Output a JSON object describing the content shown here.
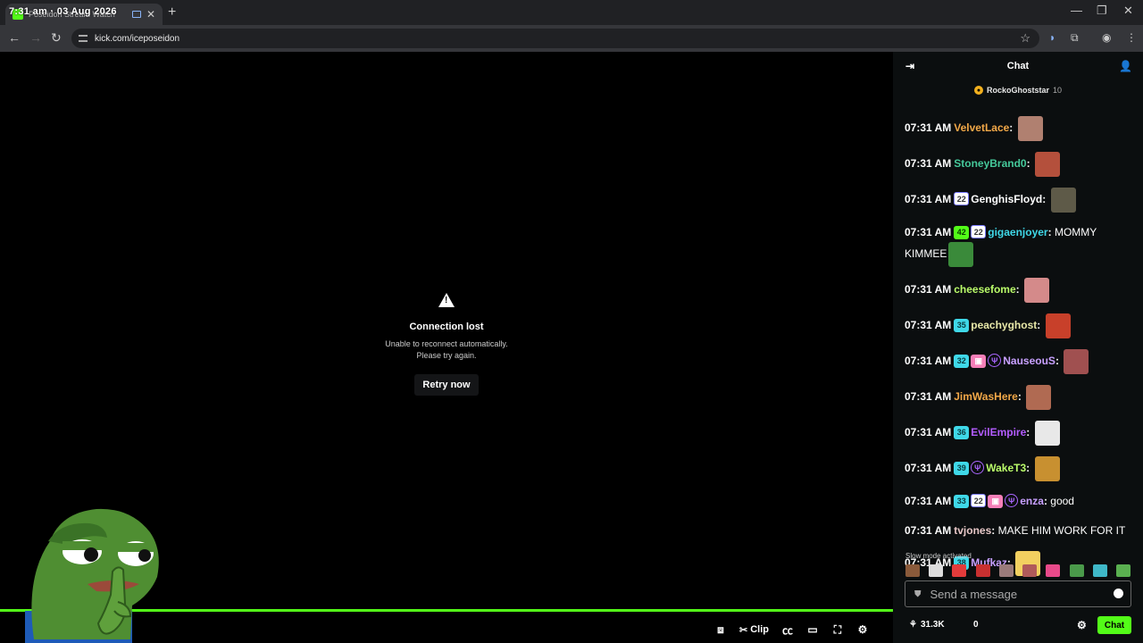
{
  "browser": {
    "tab_title": "Poseidon Stream Watch",
    "clock_overlay": "7:31 am · 03 Aug 2026",
    "url": "kick.com/iceposeidon"
  },
  "player": {
    "error_title": "Connection lost",
    "error_message_line1": "Unable to reconnect automatically.",
    "error_message_line2": "Please try again.",
    "retry_label": "Retry now",
    "clip_label": "Clip"
  },
  "chat": {
    "header": "Chat",
    "pinned": {
      "user": "RockoGhoststar",
      "count": "10"
    },
    "messages": [
      {
        "time": "07:31 AM",
        "user": "VelvetLace",
        "color": "#f2a848",
        "badges": [],
        "text": "",
        "emote": "#b08070"
      },
      {
        "time": "07:31 AM",
        "user": "StoneyBrand0",
        "color": "#45c89a",
        "badges": [],
        "text": "",
        "emote": "#b4503c"
      },
      {
        "time": "07:31 AM",
        "user": "GenghisFloyd",
        "color": "#ffffff",
        "badges": [
          "22"
        ],
        "text": "",
        "emote": "#5e5a48"
      },
      {
        "time": "07:31 AM",
        "user": "gigaenjoyer",
        "color": "#3fd8e8",
        "badges": [
          "42",
          "22"
        ],
        "text": "MOMMY KIMMEE",
        "emote": "#3a8a3a"
      },
      {
        "time": "07:31 AM",
        "user": "cheesefome",
        "color": "#bafc6a",
        "badges": [],
        "text": "",
        "emote": "#d48a8a"
      },
      {
        "time": "07:31 AM",
        "user": "peachyghost",
        "color": "#e8e8a8",
        "badges": [
          "35"
        ],
        "text": "",
        "emote": "#c8402a"
      },
      {
        "time": "07:31 AM",
        "user": "NauseouS",
        "color": "#c8a0ff",
        "badges": [
          "32",
          "gift",
          "og"
        ],
        "text": "",
        "emote": "#a05050"
      },
      {
        "time": "07:31 AM",
        "user": "JimWasHere",
        "color": "#f2a848",
        "badges": [],
        "text": "",
        "emote": "#b06a52"
      },
      {
        "time": "07:31 AM",
        "user": "EvilEmpire",
        "color": "#b35cff",
        "badges": [
          "36"
        ],
        "text": "",
        "emote": "#e8e8e8"
      },
      {
        "time": "07:31 AM",
        "user": "WakeT3",
        "color": "#bafc6a",
        "badges": [
          "39",
          "og"
        ],
        "text": "",
        "emote": "#c89030"
      },
      {
        "time": "07:31 AM",
        "user": "enza",
        "color": "#c8a0ff",
        "badges": [
          "33",
          "22",
          "gift",
          "og"
        ],
        "text": "good",
        "emote": ""
      },
      {
        "time": "07:31 AM",
        "user": "tvjones",
        "color": "#e8c8c8",
        "badges": [],
        "text": "MAKE HIM WORK FOR IT",
        "emote": ""
      },
      {
        "time": "07:31 AM",
        "user": "Mufkaz",
        "color": "#c8a0ff",
        "badges": [
          "38"
        ],
        "text": "",
        "emote": "#f2d060"
      }
    ],
    "slow_mode": "Slow mode activated",
    "input_placeholder": "Send a message",
    "viewers": "31.3K",
    "points": "0",
    "chat_button": "Chat"
  }
}
